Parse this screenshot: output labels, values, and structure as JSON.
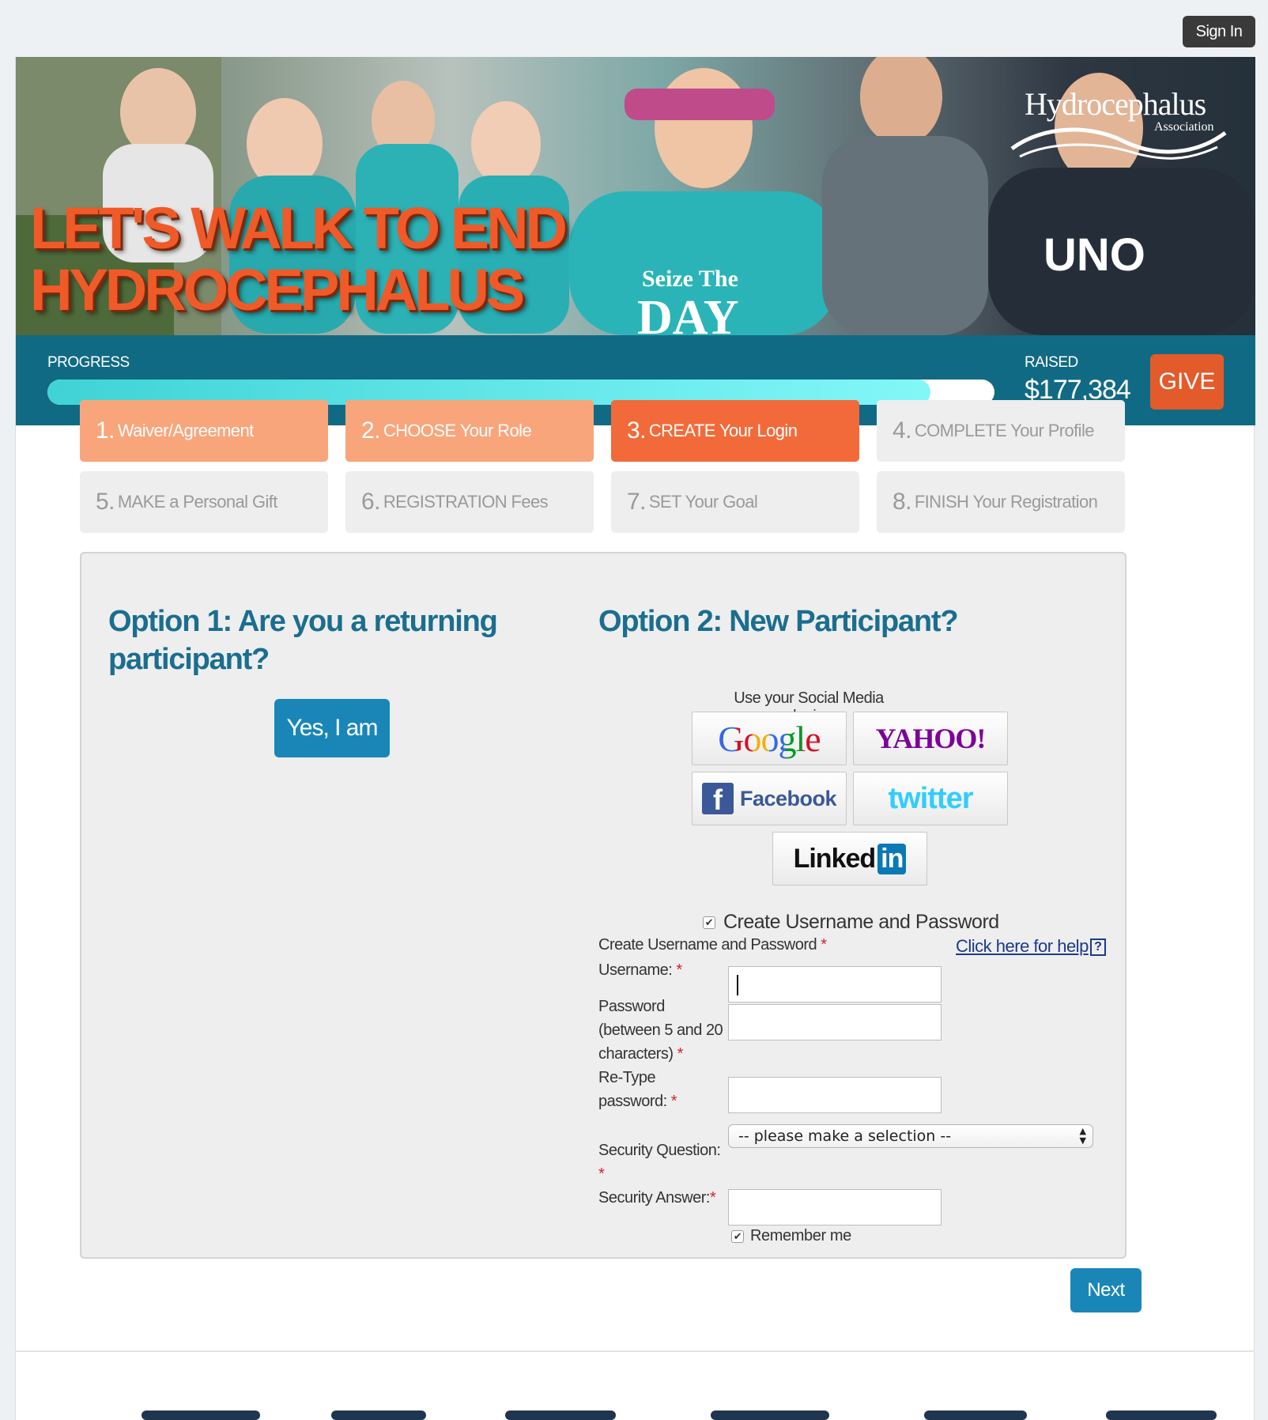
{
  "header": {
    "signin_label": "Sign In"
  },
  "banner": {
    "headline_line1": "LET'S WALK TO END",
    "headline_line2": "HYDROCEPHALUS",
    "logo_title": "Hydrocephalus",
    "logo_sub": "Association"
  },
  "progress": {
    "label": "PROGRESS",
    "fill_fraction": 0.932,
    "raised_label": "RAISED",
    "raised_amount": "$177,384",
    "give_label": "GIVE"
  },
  "steps": [
    {
      "num": "1.",
      "label": "Waiver/Agreement",
      "state": "done"
    },
    {
      "num": "2.",
      "label": "CHOOSE Your Role",
      "state": "done"
    },
    {
      "num": "3.",
      "label": "CREATE Your Login",
      "state": "active"
    },
    {
      "num": "4.",
      "label": "COMPLETE Your Profile",
      "state": "todo"
    },
    {
      "num": "5.",
      "label": "MAKE a Personal Gift",
      "state": "todo"
    },
    {
      "num": "6.",
      "label": "REGISTRATION Fees",
      "state": "todo"
    },
    {
      "num": "7.",
      "label": "SET Your Goal",
      "state": "todo"
    },
    {
      "num": "8.",
      "label": "FINISH Your Registration",
      "state": "todo"
    }
  ],
  "option1": {
    "title": "Option 1: Are you a returning participant?",
    "button": "Yes, I am"
  },
  "option2": {
    "title": "Option 2: New Participant?",
    "social_label": "Use your Social Media login",
    "social": {
      "google": "Google",
      "yahoo": "YAHOO!",
      "facebook_letter": "f",
      "facebook": "Facebook",
      "twitter": "twitter",
      "linkedin": "Linked",
      "linkedin_in": "in"
    }
  },
  "form": {
    "toggle_label": "Create Username and Password",
    "toggle_checked": true,
    "heading": "Create Username and Password",
    "help_link": "Click here for help",
    "help_icon": "?",
    "required_mark": "*",
    "username_label": "Username:",
    "username_value": "",
    "password_label": "Password (between 5 and 20 characters)",
    "retype_label": "Re-Type password:",
    "question_label": "Security Question:",
    "question_value": "-- please make a selection --",
    "answer_label": "Security Answer:",
    "remember_label": "Remember me",
    "remember_checked": true
  },
  "footer": {
    "next_label": "Next"
  },
  "colors": {
    "brand_teal": "#116a84",
    "accent_orange": "#f26a3a",
    "step_done": "#f9a57b",
    "button_blue": "#1a86b8",
    "title_blue": "#1a6e8f"
  }
}
